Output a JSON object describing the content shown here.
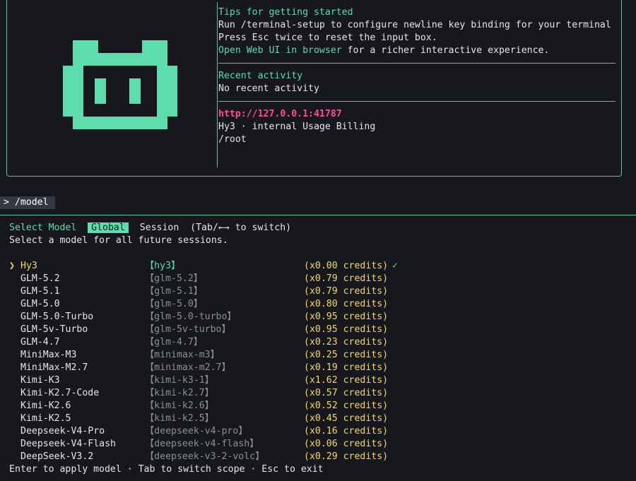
{
  "welcome": {
    "tips_title": "Tips for getting started",
    "tip1": "Run /terminal-setup to configure newline key binding for your terminal",
    "tip2": "Press Esc twice to reset the input box.",
    "tip3_link": "Open Web UI in browser",
    "tip3_rest": " for a richer interactive experience.",
    "recent_title": "Recent activity",
    "recent_value": "No recent activity",
    "url": "http://127.0.0.1:41787",
    "account": "Hy3 · internal Usage Billing",
    "cwd": "/root"
  },
  "prompt": {
    "text": "> /model"
  },
  "selector": {
    "title": "Select Model",
    "scope_global": "Global",
    "scope_session": "Session",
    "switch_hint": "(Tab/←→ to switch)",
    "subtitle": "Select a model for all future sessions.",
    "selected_marker": "❯",
    "check": "✓"
  },
  "models": [
    {
      "name": "Hy3",
      "id": "【hy3】",
      "cost": "(x0.00 credits)",
      "selected": true
    },
    {
      "name": "GLM-5.2",
      "id": "【glm-5.2】",
      "cost": "(x0.79 credits)"
    },
    {
      "name": "GLM-5.1",
      "id": "【glm-5.1】",
      "cost": "(x0.79 credits)"
    },
    {
      "name": "GLM-5.0",
      "id": "【glm-5.0】",
      "cost": "(x0.80 credits)"
    },
    {
      "name": "GLM-5.0-Turbo",
      "id": "【glm-5.0-turbo】",
      "cost": "(x0.95 credits)"
    },
    {
      "name": "GLM-5v-Turbo",
      "id": "【glm-5v-turbo】",
      "cost": "(x0.95 credits)"
    },
    {
      "name": "GLM-4.7",
      "id": "【glm-4.7】",
      "cost": "(x0.23 credits)"
    },
    {
      "name": "MiniMax-M3",
      "id": "【minimax-m3】",
      "cost": "(x0.25 credits)"
    },
    {
      "name": "MiniMax-M2.7",
      "id": "【minimax-m2.7】",
      "cost": "(x0.19 credits)"
    },
    {
      "name": "Kimi-K3",
      "id": "【kimi-k3-1】",
      "cost": "(x1.62 credits)"
    },
    {
      "name": "Kimi-K2.7-Code",
      "id": "【kimi-k2.7】",
      "cost": "(x0.57 credits)"
    },
    {
      "name": "Kimi-K2.6",
      "id": "【kimi-k2.6】",
      "cost": "(x0.52 credits)"
    },
    {
      "name": "Kimi-K2.5",
      "id": "【kimi-k2.5】",
      "cost": "(x0.45 credits)"
    },
    {
      "name": "Deepseek-V4-Pro",
      "id": "【deepseek-v4-pro】",
      "cost": "(x0.16 credits)"
    },
    {
      "name": "Deepseek-V4-Flash",
      "id": "【deepseek-v4-flash】",
      "cost": "(x0.06 credits)"
    },
    {
      "name": "DeepSeek-V3.2",
      "id": "【deepseek-v3-2-volc】",
      "cost": "(x0.29 credits)"
    }
  ],
  "footer": {
    "text": "Enter to apply model · Tab to switch scope · Esc to exit"
  },
  "colors": {
    "accent": "#5fdcab",
    "highlight": "#f5d76e",
    "url": "#ff4d9d",
    "background": "#16181d"
  },
  "icons": {
    "logo": "robot-mascot-icon"
  }
}
